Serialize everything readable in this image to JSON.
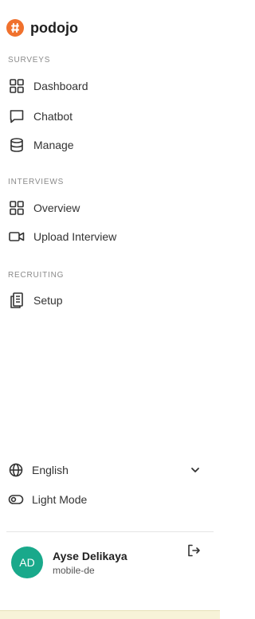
{
  "brand": {
    "name": "podojo",
    "logo_color": "#f0712d"
  },
  "sections": {
    "surveys": "SURVEYS",
    "interviews": "INTERVIEWS",
    "recruiting": "RECRUITING"
  },
  "nav": {
    "dashboard": {
      "label": "Dashboard",
      "icon": "grid-icon"
    },
    "chatbot": {
      "label": "Chatbot",
      "icon": "chat-bubble-icon"
    },
    "manage": {
      "label": "Manage",
      "icon": "database-icon"
    },
    "overview": {
      "label": "Overview",
      "icon": "grid-icon"
    },
    "upload_interview": {
      "label": "Upload Interview",
      "icon": "video-camera-icon"
    },
    "setup": {
      "label": "Setup",
      "icon": "document-clipboard-icon"
    }
  },
  "footer": {
    "language": "English",
    "mode": "Light Mode"
  },
  "user": {
    "initials": "AD",
    "name": "Ayse Delikaya",
    "org": "mobile-de",
    "avatar_color": "#19a98b"
  }
}
